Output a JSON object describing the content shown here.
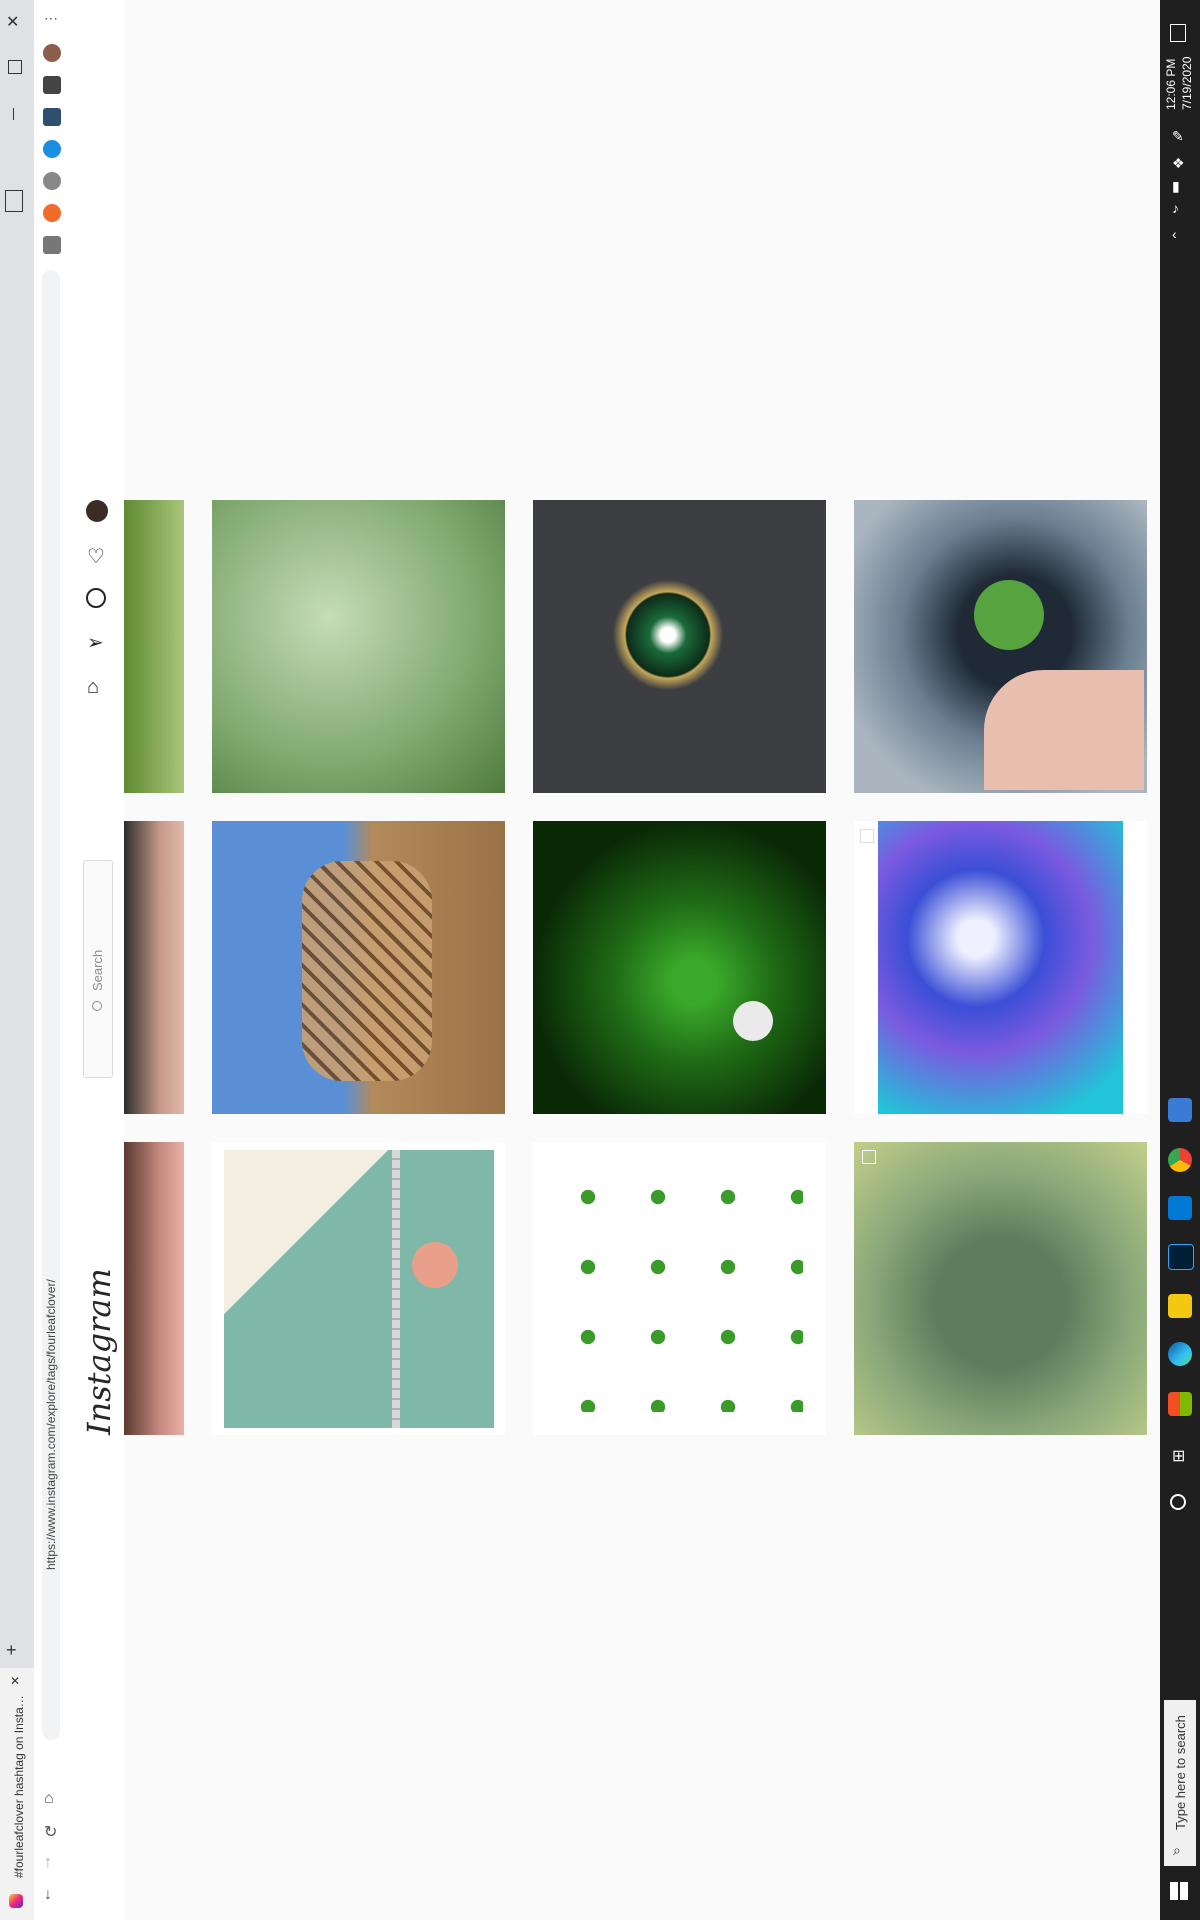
{
  "browser": {
    "tab_title": "#fourleafclover hashtag on Insta…",
    "url": "https://www.instagram.com/explore/tags/fourleafclover/",
    "new_tab_symbol": "+",
    "close_symbol": "✕",
    "more_symbol": "⋯"
  },
  "instagram": {
    "logo_text": "Instagram",
    "search_placeholder": "Search"
  },
  "grid": {
    "tiles": [
      {
        "name": "clover-hand-partial",
        "colors": [
          "#6c8e3e",
          "#9fbf6a"
        ]
      },
      {
        "name": "clover-field",
        "colors": [
          "#7fa86e",
          "#c5dcb8"
        ]
      },
      {
        "name": "clover-brooch",
        "colors": [
          "#3d3e42",
          "#1a6b3a"
        ]
      },
      {
        "name": "clover-camera-lens",
        "colors": [
          "#6a7f92",
          "#56a340"
        ]
      },
      {
        "name": "hand-partial",
        "colors": [
          "#c79a8a",
          "#2d2d2d"
        ]
      },
      {
        "name": "giraffes",
        "colors": [
          "#5a8fd6",
          "#b38a5a"
        ]
      },
      {
        "name": "clover-leaves-dark",
        "colors": [
          "#0a2a06",
          "#3aa82a"
        ]
      },
      {
        "name": "blue-flowers",
        "colors": [
          "#3a4fd6",
          "#21c4d8"
        ]
      },
      {
        "name": "hand-partial-2",
        "colors": [
          "#c78a80",
          "#5a3a30"
        ]
      },
      {
        "name": "clover-bracelet",
        "colors": [
          "#7fb8a8",
          "#e9b1a0"
        ]
      },
      {
        "name": "pressed-clovers",
        "colors": [
          "#ffffff",
          "#3a9a2a"
        ]
      },
      {
        "name": "clover-raindrops",
        "colors": [
          "#5d7d5d",
          "#8aa87a"
        ]
      }
    ]
  },
  "taskbar": {
    "time": "12:06 PM",
    "date": "7/19/2020",
    "search_placeholder": "Type here to search"
  }
}
